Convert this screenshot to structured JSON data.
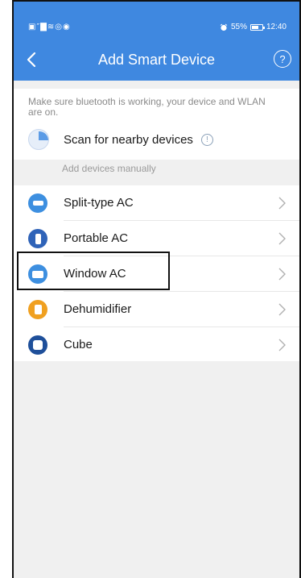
{
  "status_bar": {
    "left_icons": "▣″▇≋◎◉",
    "alarm_icon": "alarm-icon",
    "battery_percent": "55%",
    "battery_level": 0.55,
    "time": "12:40"
  },
  "navbar": {
    "title": "Add Smart Device",
    "back_icon": "chevron-left-icon",
    "help_glyph": "?"
  },
  "info": {
    "text": "Make sure bluetooth is working, your device and WLAN are on.",
    "scan_label": "Scan for nearby devices",
    "scan_info_glyph": "!"
  },
  "section": {
    "manual_label": "Add devices manually"
  },
  "devices": [
    {
      "label": "Split-type AC",
      "icon": "split-ac-icon",
      "color": "#3d8fe0"
    },
    {
      "label": "Portable AC",
      "icon": "portable-ac-icon",
      "color": "#2f63b8"
    },
    {
      "label": "Window AC",
      "icon": "window-ac-icon",
      "color": "#3d8fe0"
    },
    {
      "label": "Dehumidifier",
      "icon": "dehumidifier-icon",
      "color": "#f0a020"
    },
    {
      "label": "Cube",
      "icon": "cube-icon",
      "color": "#1e4f9a"
    }
  ],
  "colors": {
    "header": "#3f88e0",
    "background": "#f0f0f0"
  }
}
